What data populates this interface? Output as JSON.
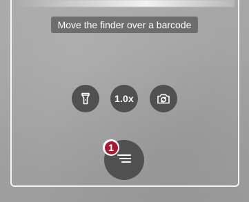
{
  "scanner": {
    "hint_text": "Move the finder over a barcode"
  },
  "controls": {
    "torch_icon": "flashlight-icon",
    "zoom_label": "1.0x",
    "flip_icon": "camera-switch-icon"
  },
  "results": {
    "icon": "list-icon",
    "count": "1",
    "badge_color": "#a51b32"
  }
}
